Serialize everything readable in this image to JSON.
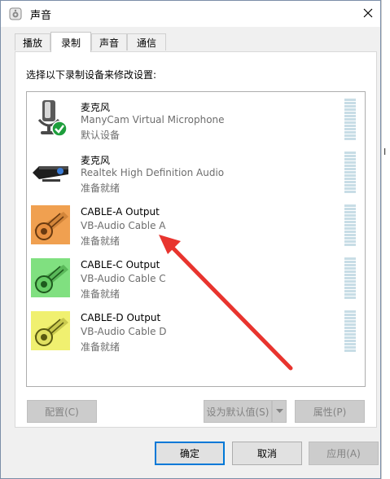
{
  "window": {
    "title": "声音",
    "icon": "speaker-icon",
    "close_icon": "close-icon"
  },
  "tabs": [
    {
      "label": "播放",
      "active": false
    },
    {
      "label": "录制",
      "active": true
    },
    {
      "label": "声音",
      "active": false
    },
    {
      "label": "通信",
      "active": false
    }
  ],
  "recording": {
    "instruction": "选择以下录制设备来修改设置:",
    "devices": [
      {
        "name": "麦克风",
        "description": "ManyCam Virtual Microphone",
        "status": "默认设备",
        "icon": "microphone-icon",
        "is_default": true
      },
      {
        "name": "麦克风",
        "description": "Realtek High Definition Audio",
        "status": "准备就绪",
        "icon": "webcam-microphone-icon",
        "is_default": false
      },
      {
        "name": "CABLE-A Output",
        "description": "VB-Audio Cable A",
        "status": "准备就绪",
        "icon": "cable-connector-icon",
        "color": "#f0a050"
      },
      {
        "name": "CABLE-C Output",
        "description": "VB-Audio Cable C",
        "status": "准备就绪",
        "icon": "cable-connector-icon",
        "color": "#80e080"
      },
      {
        "name": "CABLE-D Output",
        "description": "VB-Audio Cable D",
        "status": "准备就绪",
        "icon": "cable-connector-icon",
        "color": "#f0f070"
      }
    ],
    "configure_label": "配置(C)",
    "set_default_label": "设为默认值(S)",
    "properties_label": "属性(P)"
  },
  "dialog": {
    "ok_label": "确定",
    "cancel_label": "取消",
    "apply_label": "应用(A)"
  },
  "colors": {
    "annotation_arrow": "#e8342e",
    "accent": "#0078d7",
    "meter": "#c8dde6",
    "default_check": "#1e9e3c"
  }
}
